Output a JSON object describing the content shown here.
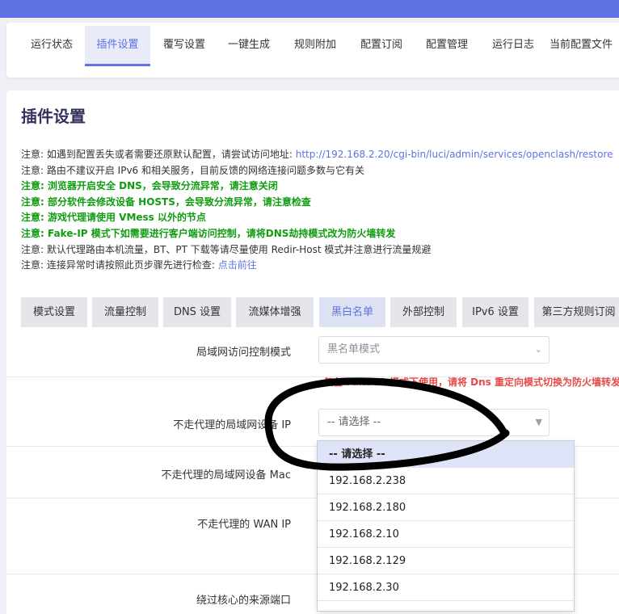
{
  "nav": {
    "tabs": [
      {
        "label": "运行状态"
      },
      {
        "label": "插件设置"
      },
      {
        "label": "覆写设置"
      },
      {
        "label": "一键生成"
      },
      {
        "label": "规则附加"
      },
      {
        "label": "配置订阅"
      },
      {
        "label": "配置管理"
      },
      {
        "label": "运行日志"
      },
      {
        "label": "当前配置文件"
      }
    ],
    "active_index": 1
  },
  "page": {
    "title": "插件设置"
  },
  "notes": {
    "n1_text": "注意: 如遇到配置丢失或者需要还原默认配置，请尝试访问地址: ",
    "n1_link": "http://192.168.2.20/cgi-bin/luci/admin/services/openclash/restore",
    "n2": "注意: 路由不建议开启 IPv6 和相关服务，目前反馈的网络连接问题多数与它有关",
    "n3": "注意: 浏览器开启安全 DNS，会导致分流异常，请注意关闭",
    "n4": "注意: 部分软件会修改设备 HOSTS，会导致分流异常，请注意检查",
    "n5": "注意: 游戏代理请使用 VMess 以外的节点",
    "n6": "注意: Fake-IP 模式下如需要进行客户端访问控制，请将DNS劫持模式改为防火墙转发",
    "n7": "注意: 默认代理路由本机流量，BT、PT 下载等请尽量使用 Redir-Host 模式并注意进行流量规避",
    "n8_text": "注意: 连接异常时请按照此页步骤先进行检查: ",
    "n8_link": "点击前往"
  },
  "subtabs": [
    {
      "label": "模式设置"
    },
    {
      "label": "流量控制"
    },
    {
      "label": "DNS 设置"
    },
    {
      "label": "流媒体增强"
    },
    {
      "label": "黑白名单"
    },
    {
      "label": "外部控制"
    },
    {
      "label": "IPv6 设置"
    },
    {
      "label": "第三方规则订阅"
    }
  ],
  "form": {
    "lan_mode_label": "局域网访问控制模式",
    "lan_mode_value": "黑名单模式",
    "warning": "仅在 Fake-IP 模式下使用，请将 Dns 重定向模式切换为防火墙转发",
    "lan_ip_label": "不走代理的局域网设备 IP",
    "lan_ip_value": "-- 请选择 --",
    "lan_mac_label": "不走代理的局域网设备 Mac",
    "wan_ip_label": "不走代理的 WAN IP",
    "bypass_port_label": "绕过核心的来源端口"
  },
  "dropdown": {
    "options": [
      "-- 请选择 --",
      "192.168.2.238",
      "192.168.2.180",
      "192.168.2.10",
      "192.168.2.129",
      "192.168.2.30"
    ]
  },
  "colors": {
    "accent": "#5e72e4",
    "note_green": "#109b10",
    "warning_red": "#e64a4a"
  }
}
